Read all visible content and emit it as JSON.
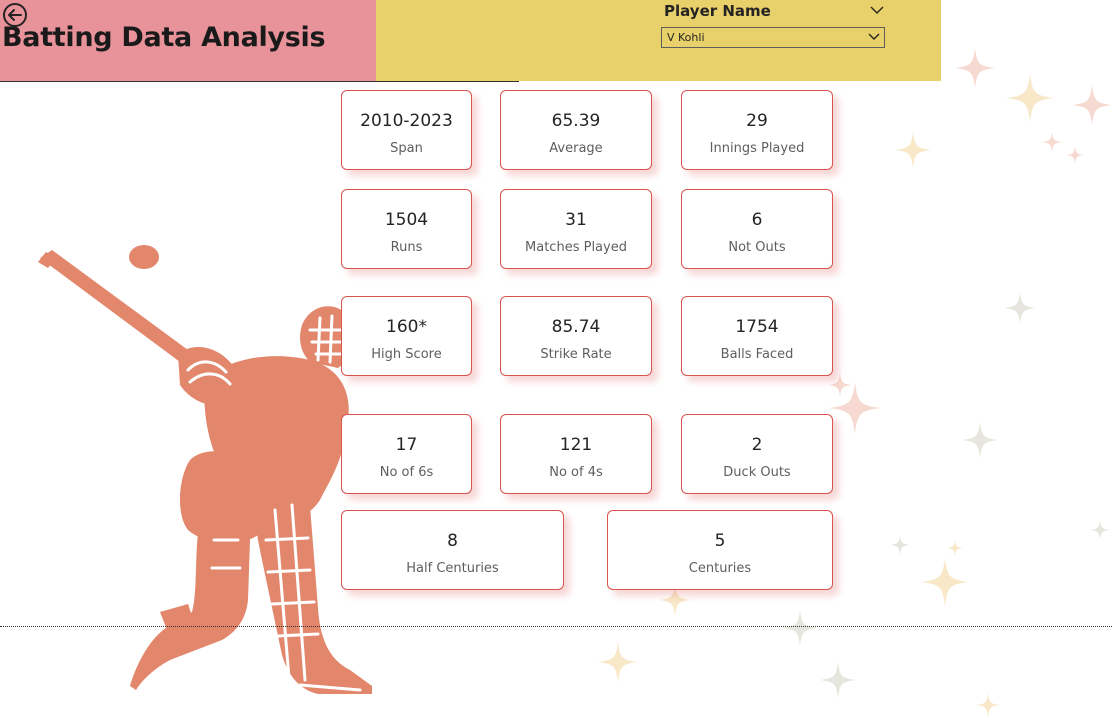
{
  "header": {
    "title": "Batting Data Analysis",
    "pink_color": "#e8929a",
    "yellow_color": "#e8d06a"
  },
  "back_icon": "back-arrow-icon",
  "slicer": {
    "label": "Player Name",
    "selected": "V Kohli"
  },
  "cards": [
    {
      "value": "2010-2023",
      "label": "Span"
    },
    {
      "value": "65.39",
      "label": "Average"
    },
    {
      "value": "29",
      "label": "Innings Played"
    },
    {
      "value": "1504",
      "label": "Runs"
    },
    {
      "value": "31",
      "label": "Matches Played"
    },
    {
      "value": "6",
      "label": "Not Outs"
    },
    {
      "value": "160*",
      "label": "High Score"
    },
    {
      "value": "85.74",
      "label": "Strike Rate"
    },
    {
      "value": "1754",
      "label": "Balls Faced"
    },
    {
      "value": "17",
      "label": "No of 6s"
    },
    {
      "value": "121",
      "label": "No of 4s"
    },
    {
      "value": "2",
      "label": "Duck Outs"
    },
    {
      "value": "8",
      "label": "Half Centuries"
    },
    {
      "value": "5",
      "label": "Centuries"
    }
  ],
  "colors": {
    "card_border": "#d9534f",
    "batsman": "#e3876c"
  }
}
